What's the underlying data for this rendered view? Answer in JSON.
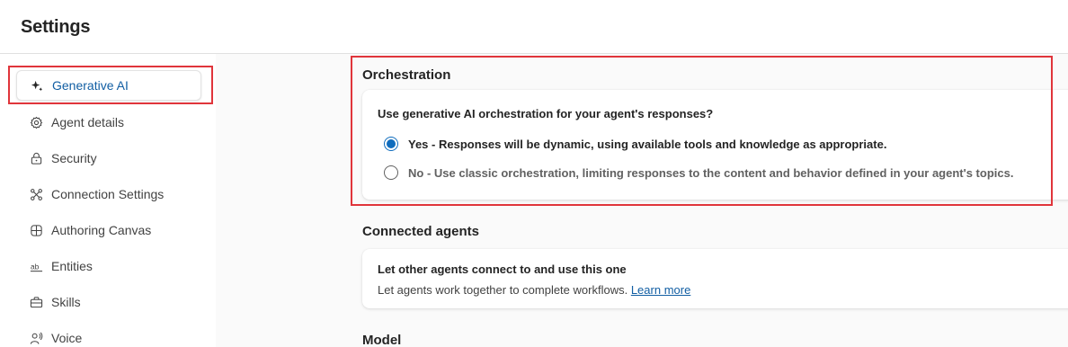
{
  "header": {
    "title": "Settings"
  },
  "sidebar": {
    "items": [
      {
        "label": "Generative AI",
        "icon": "sparkle-icon",
        "active": true
      },
      {
        "label": "Agent details",
        "icon": "gear-icon"
      },
      {
        "label": "Security",
        "icon": "lock-icon"
      },
      {
        "label": "Connection Settings",
        "icon": "connection-icon"
      },
      {
        "label": "Authoring Canvas",
        "icon": "grid-icon"
      },
      {
        "label": "Entities",
        "icon": "text-ab-icon"
      },
      {
        "label": "Skills",
        "icon": "briefcase-icon"
      },
      {
        "label": "Voice",
        "icon": "person-voice-icon"
      }
    ]
  },
  "orchestration": {
    "title": "Orchestration",
    "question": "Use generative AI orchestration for your agent's responses?",
    "options": [
      {
        "label": "Yes - Responses will be dynamic, using available tools and knowledge as appropriate.",
        "checked": true
      },
      {
        "label": "No - Use classic orchestration, limiting responses to the content and behavior defined in your agent's topics.",
        "checked": false
      }
    ]
  },
  "connected_agents": {
    "title": "Connected agents",
    "heading": "Let other agents connect to and use this one",
    "description": "Let agents work together to complete workflows.",
    "link": "Learn more"
  },
  "model": {
    "title": "Model"
  },
  "colors": {
    "accent": "#0f6cbd",
    "highlight": "#e0353b"
  }
}
